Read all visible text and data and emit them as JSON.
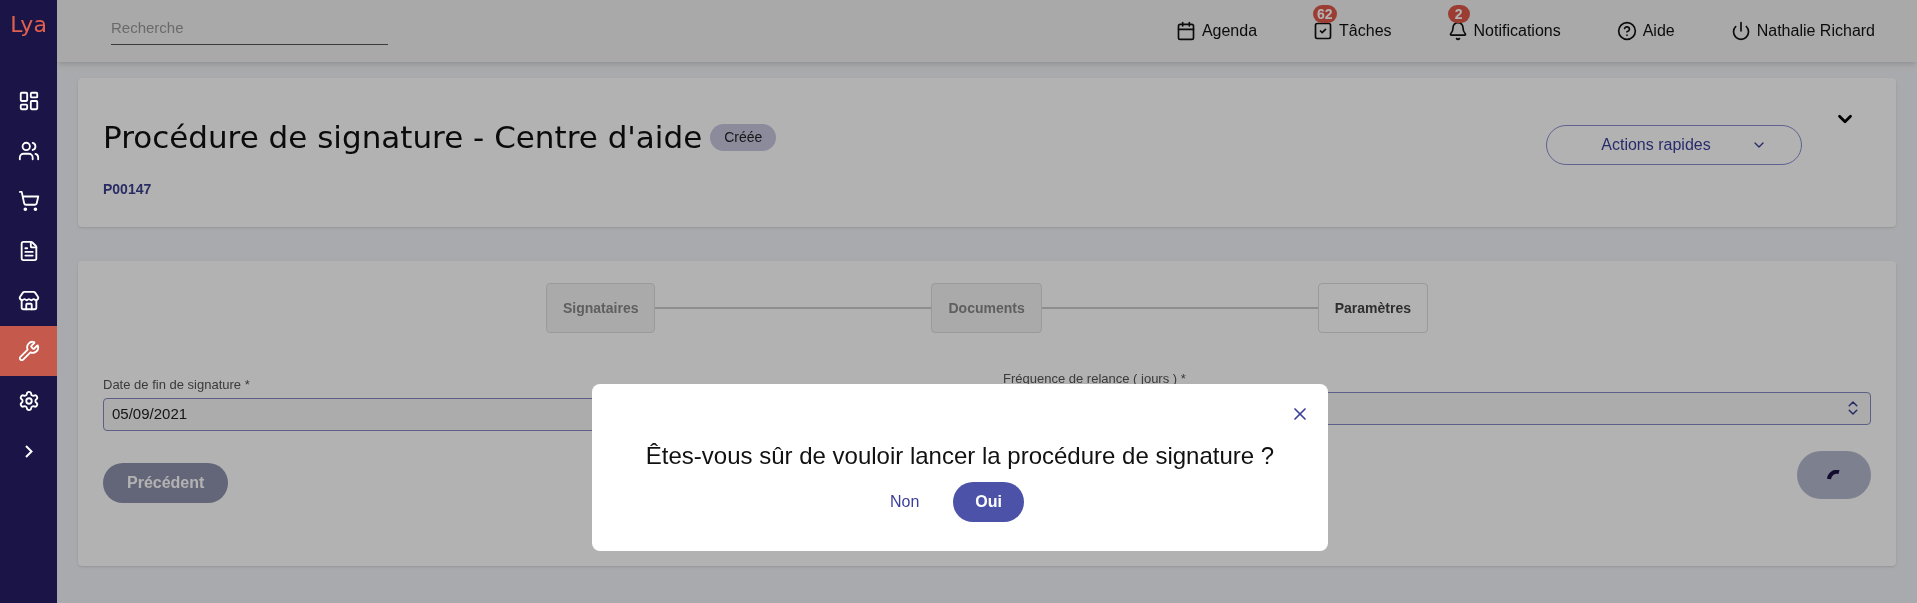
{
  "sidebar": {
    "logo": "Lya",
    "items": [
      {
        "selected": false
      },
      {
        "selected": false
      },
      {
        "selected": false
      },
      {
        "selected": false
      },
      {
        "selected": false
      },
      {
        "selected": true
      },
      {
        "selected": false
      },
      {
        "selected": false
      }
    ]
  },
  "topbar": {
    "search": {
      "placeholder": "Recherche"
    },
    "nav": [
      {
        "label": "Agenda"
      },
      {
        "label": "Tâches",
        "badge": "62"
      },
      {
        "label": "Notifications",
        "badge": "2"
      },
      {
        "label": "Aide"
      },
      {
        "label": "Nathalie Richard"
      }
    ]
  },
  "header": {
    "title": "Procédure de signature - Centre d'aide",
    "status": "Créée",
    "reference": "P00147",
    "quick_actions": "Actions rapides"
  },
  "steps": [
    {
      "label": "Signataires",
      "selected": false
    },
    {
      "label": "Documents",
      "selected": false
    },
    {
      "label": "Paramètres",
      "selected": true
    }
  ],
  "fields": [
    {
      "label": "Date de fin de signature *",
      "value": "05/09/2021"
    },
    {
      "label": "Fréquence de relance ( jours ) *"
    }
  ],
  "buttons": {
    "previous": {
      "label": "Précédent",
      "disabled": true
    },
    "next": {
      "loading": true
    }
  },
  "dialog": {
    "message": "Êtes-vous sûr de vouloir lancer la procédure de signature ?",
    "cancel": "Non",
    "confirm": "Oui"
  }
}
